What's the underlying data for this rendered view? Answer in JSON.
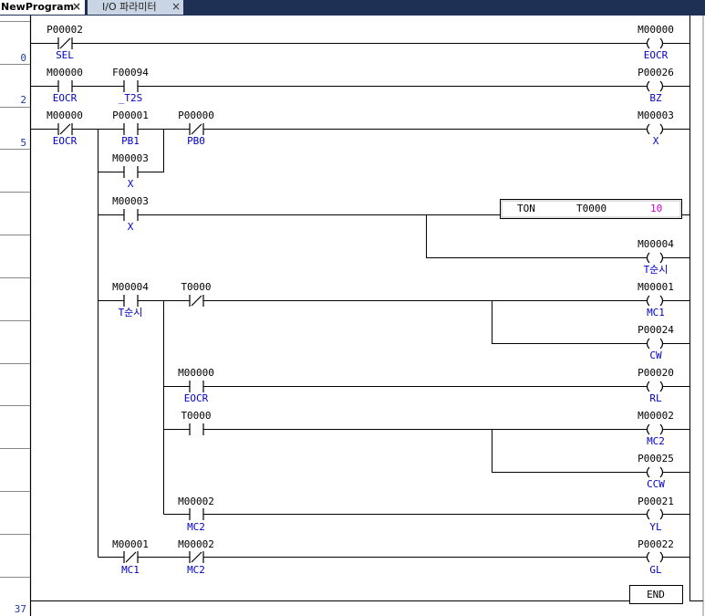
{
  "tabs": [
    {
      "label": "NewProgram",
      "close": "×"
    },
    {
      "label": "I/O 파라미터",
      "close": "×"
    }
  ],
  "row_numbers": [
    "0",
    "2",
    "5",
    "37"
  ],
  "rungs": {
    "r0": {
      "sel_addr": "P00002",
      "sel_cmt": "SEL",
      "eocr_addr": "M00000",
      "eocr_cmt": "EOCR"
    },
    "r2": {
      "eocr_addr": "M00000",
      "eocr_cmt": "EOCR",
      "t2s_addr": "F00094",
      "t2s_cmt": "_T2S",
      "bz_addr": "P00026",
      "bz_cmt": "BZ"
    },
    "r5": {
      "eocr_addr": "M00000",
      "eocr_cmt": "EOCR",
      "pb1_addr": "P00001",
      "pb1_cmt": "PB1",
      "pb0_addr": "P00000",
      "pb0_cmt": "PB0",
      "x_addr": "M00003",
      "x_cmt": "X",
      "xself_addr": "M00003",
      "xself_cmt": "X"
    },
    "timer": {
      "x_addr": "M00003",
      "x_cmt": "X",
      "ton": "TON",
      "tname": "T0000",
      "preset": "10",
      "tsun_addr": "M00004",
      "tsun_cmt": "T순시"
    },
    "mc1": {
      "tsun_addr": "M00004",
      "tsun_cmt": "T순시",
      "t_addr": "T0000",
      "mc1_addr": "M00001",
      "mc1_cmt": "MC1",
      "cw_addr": "P00024",
      "cw_cmt": "CW"
    },
    "rl": {
      "eocr_addr": "M00000",
      "eocr_cmt": "EOCR",
      "rl_addr": "P00020",
      "rl_cmt": "RL"
    },
    "mc2": {
      "t_addr": "T0000",
      "mc2_addr": "M00002",
      "mc2_cmt": "MC2",
      "ccw_addr": "P00025",
      "ccw_cmt": "CCW"
    },
    "yl": {
      "mc2_addr": "M00002",
      "mc2_cmt": "MC2",
      "yl_addr": "P00021",
      "yl_cmt": "YL"
    },
    "gl": {
      "mc1_addr": "M00001",
      "mc1_cmt": "MC1",
      "mc2_addr": "M00002",
      "mc2_cmt": "MC2",
      "gl_addr": "P00022",
      "gl_cmt": "GL"
    },
    "end": "END"
  },
  "colors": {
    "tabbar": "#1e3054",
    "comment": "#0000c8",
    "preset": "#cc00cc",
    "rownum": "#1a3aa8"
  }
}
